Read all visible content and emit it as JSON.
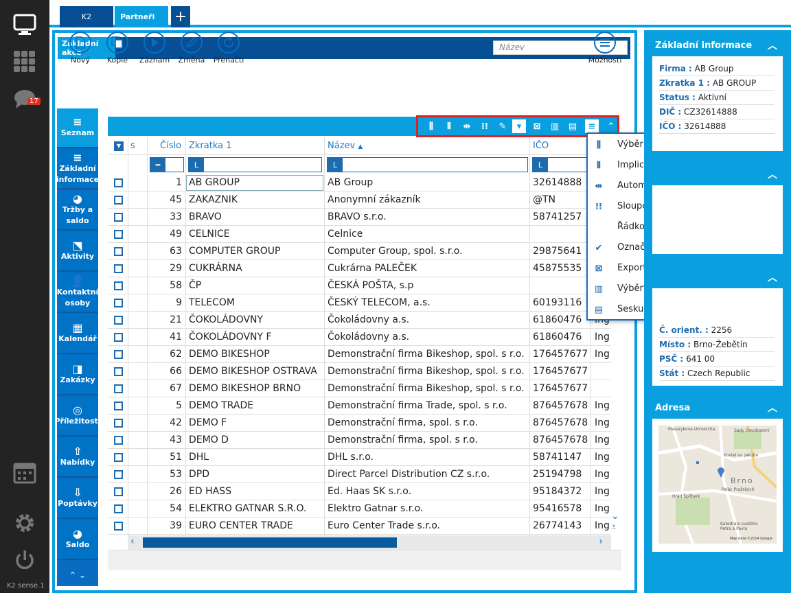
{
  "app": {
    "version": "K2 sense.1",
    "notif_count": "17"
  },
  "tabs": [
    {
      "label": "K2"
    },
    {
      "label": "Partneři"
    }
  ],
  "action_bar": {
    "label": "Základní akce",
    "search_placeholder": "Název"
  },
  "toolbar": {
    "new": "Nový",
    "copy": "Kopie",
    "record": "Záznam",
    "edit": "Změna",
    "reload": "Přenačti",
    "options": "Možnosti"
  },
  "vnav": [
    {
      "label": "Seznam",
      "icon": "list-icon"
    },
    {
      "label": "Základní informace",
      "icon": "list-icon"
    },
    {
      "label": "Tržby a saldo",
      "icon": "pie-chart-icon"
    },
    {
      "label": "Aktivity",
      "icon": "activity-icon"
    },
    {
      "label": "Kontaktní osoby",
      "icon": "contacts-icon"
    },
    {
      "label": "Kalendář",
      "icon": "calendar-icon"
    },
    {
      "label": "Zakázky",
      "icon": "orders-icon"
    },
    {
      "label": "Příležitosti",
      "icon": "target-icon"
    },
    {
      "label": "Nabídky",
      "icon": "upload-icon"
    },
    {
      "label": "Poptávky",
      "icon": "download-icon"
    },
    {
      "label": "Saldo",
      "icon": "pie-chart-icon"
    }
  ],
  "grid": {
    "columns": {
      "s": "s",
      "cislo": "Číslo",
      "zkratka": "Zkratka 1",
      "nazev": "Název",
      "ico": "IČO"
    },
    "rows": [
      {
        "cislo": "1",
        "zkratka": "AB GROUP",
        "nazev": "AB Group",
        "ico": "32614888",
        "extra": ""
      },
      {
        "cislo": "45",
        "zkratka": "ZAKAZNIK",
        "nazev": "Anonymní zákazník",
        "ico": "@TN",
        "extra": ""
      },
      {
        "cislo": "33",
        "zkratka": "BRAVO",
        "nazev": "BRAVO s.r.o.",
        "ico": "58741257",
        "extra": ""
      },
      {
        "cislo": "49",
        "zkratka": "CELNICE",
        "nazev": "Celnice",
        "ico": "",
        "extra": ""
      },
      {
        "cislo": "63",
        "zkratka": "COMPUTER GROUP",
        "nazev": "Computer Group, spol. s.r.o.",
        "ico": "29875641",
        "extra": ""
      },
      {
        "cislo": "29",
        "zkratka": "CUKRÁRNA",
        "nazev": "Cukrárna PALEČEK",
        "ico": "45875535",
        "extra": ""
      },
      {
        "cislo": "58",
        "zkratka": "ČP",
        "nazev": "ČESKÁ POŠTA, s.p",
        "ico": "",
        "extra": ""
      },
      {
        "cislo": "9",
        "zkratka": "TELECOM",
        "nazev": "ČESKÝ TELECOM, a.s.",
        "ico": "60193116",
        "extra": ""
      },
      {
        "cislo": "21",
        "zkratka": "ČOKOLÁDOVNY",
        "nazev": "Čokoládovny a.s.",
        "ico": "61860476",
        "extra": "Ing"
      },
      {
        "cislo": "41",
        "zkratka": "ČOKOLÁDOVNY F",
        "nazev": "Čokoládovny a.s.",
        "ico": "61860476",
        "extra": "Ing"
      },
      {
        "cislo": "62",
        "zkratka": "DEMO BIKESHOP",
        "nazev": "Demonstrační firma Bikeshop, spol. s r.o.",
        "ico": "176457677",
        "extra": "Ing"
      },
      {
        "cislo": "66",
        "zkratka": "DEMO BIKESHOP OSTRAVA",
        "nazev": "Demonstrační firma Bikeshop, spol. s r.o.",
        "ico": "176457677",
        "extra": ""
      },
      {
        "cislo": "67",
        "zkratka": "DEMO BIKESHOP BRNO",
        "nazev": "Demonstrační firma Bikeshop, spol. s r.o.",
        "ico": "176457677",
        "extra": ""
      },
      {
        "cislo": "5",
        "zkratka": "DEMO TRADE",
        "nazev": "Demonstrační firma Trade, spol. s r.o.",
        "ico": "876457678",
        "extra": "Ing"
      },
      {
        "cislo": "42",
        "zkratka": "DEMO F",
        "nazev": "Demonstrační firma, spol. s r.o.",
        "ico": "876457678",
        "extra": "Ing"
      },
      {
        "cislo": "43",
        "zkratka": "DEMO D",
        "nazev": "Demonstrační firma, spol. s r.o.",
        "ico": "876457678",
        "extra": "Ing"
      },
      {
        "cislo": "51",
        "zkratka": "DHL",
        "nazev": "DHL s.r.o.",
        "ico": "58741147",
        "extra": "Ing"
      },
      {
        "cislo": "53",
        "zkratka": "DPD",
        "nazev": "Direct Parcel Distribution CZ s.r.o.",
        "ico": "25194798",
        "extra": "Ing"
      },
      {
        "cislo": "26",
        "zkratka": "ED HASS",
        "nazev": "Ed. Haas SK s.r.o.",
        "ico": "95184372",
        "extra": "Ing"
      },
      {
        "cislo": "54",
        "zkratka": "ELEKTRO GATNAR S.R.O.",
        "nazev": "Elektro Gatnar s.r.o.",
        "ico": "95416578",
        "extra": "Ing"
      },
      {
        "cislo": "39",
        "zkratka": "EURO CENTER TRADE",
        "nazev": "Euro Center Trade s.r.o.",
        "ico": "26774143",
        "extra": "Ing"
      }
    ]
  },
  "context_menu": [
    {
      "label": "Výběr sloupců",
      "icon": "column-select-icon",
      "check": false,
      "sub": false
    },
    {
      "label": "Implicitní sloupce",
      "icon": "default-columns-icon",
      "check": false,
      "sub": false
    },
    {
      "label": "Automatická šířka sloupců",
      "icon": "autowidth-icon",
      "check": false,
      "sub": false
    },
    {
      "label": "Sloupce",
      "icon": "columns-icon",
      "check": false,
      "sub": true
    },
    {
      "label": "Řádková editace",
      "icon": "",
      "check": false,
      "sub": false
    },
    {
      "label": "Označování záznamů",
      "icon": "check-icon",
      "check": true,
      "sub": false
    },
    {
      "label": "Export do excelu",
      "icon": "excel-icon",
      "check": false,
      "sub": false
    },
    {
      "label": "Výběry",
      "icon": "selection-icon",
      "check": false,
      "sub": true
    },
    {
      "label": "Seskupení",
      "icon": "group-icon",
      "check": false,
      "sub": true
    }
  ],
  "info_panel": {
    "title": "Základní informace",
    "fields": [
      {
        "k": "Firma :",
        "v": "AB Group"
      },
      {
        "k": "Zkratka 1 :",
        "v": "AB GROUP"
      },
      {
        "k": "Status :",
        "v": "Aktivní"
      },
      {
        "k": "DIČ :",
        "v": "CZ32614888"
      },
      {
        "k": "IČO :",
        "v": "32614888"
      }
    ]
  },
  "address_fields": [
    {
      "k": "Č. orient. :",
      "v": "2256"
    },
    {
      "k": "Místo :",
      "v": "Brno-Žebětín"
    },
    {
      "k": "PSČ :",
      "v": "641 00"
    },
    {
      "k": "Stát :",
      "v": "Czech Republic"
    }
  ],
  "map_panel": {
    "title": "Adresa",
    "labels": [
      "Masarykova Univerzita",
      "Sady Osvobození",
      "Kostel sv. Jakuba",
      "Brno",
      "Palác Pražských",
      "Hrad Špilberk",
      "Katedrála svatého Petra a Pavla",
      "Map data ©2014 Google"
    ]
  },
  "colors": {
    "accent": "#0aa0e0",
    "dark_blue": "#074f94",
    "highlight": "#e02020"
  }
}
